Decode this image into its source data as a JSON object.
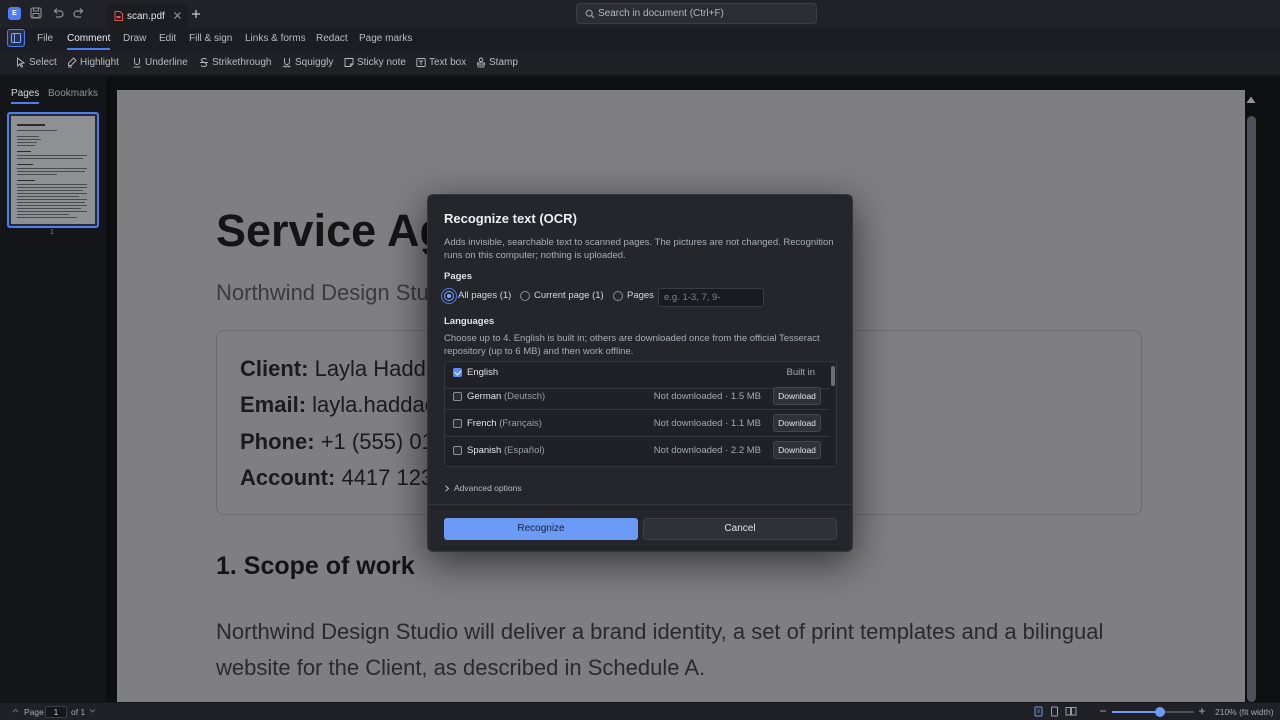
{
  "app": {
    "logo_letter": "E"
  },
  "tab": {
    "file_name": "scan.pdf"
  },
  "search": {
    "placeholder": "Search in document (Ctrl+F)"
  },
  "menu": [
    "File",
    "Comment",
    "Draw",
    "Edit",
    "Fill & sign",
    "Links & forms",
    "Redact",
    "Page marks"
  ],
  "menu_active": "Comment",
  "tools": [
    "Select",
    "Highlight",
    "Underline",
    "Strikethrough",
    "Squiggly",
    "Sticky note",
    "Text box",
    "Stamp"
  ],
  "sidebar": {
    "tabs": [
      "Pages",
      "Bookmarks"
    ],
    "active_tab": "Pages",
    "thumb_page_number": "1"
  },
  "document": {
    "title": "Service Ag",
    "subtitle": "Northwind Design Stud",
    "info": [
      {
        "key": "Client:",
        "value": "Layla Hadda"
      },
      {
        "key": "Email:",
        "value": "layla.haddad"
      },
      {
        "key": "Phone:",
        "value": "+1 (555) 014"
      },
      {
        "key": "Account:",
        "value": "4417 1234"
      }
    ],
    "section_heading": "1. Scope of work",
    "paragraph": "Northwind Design Studio will deliver a brand identity, a set of print templates and a bilingual website for the Client, as described in Schedule A."
  },
  "dialog": {
    "title": "Recognize text (OCR)",
    "description": "Adds invisible, searchable text to scanned pages. The pictures are not changed. Recognition runs on this computer; nothing is uploaded.",
    "pages_label": "Pages",
    "page_options": [
      {
        "label": "All pages (1)",
        "selected": true
      },
      {
        "label": "Current page (1)",
        "selected": false
      },
      {
        "label": "Pages",
        "selected": false
      }
    ],
    "pages_placeholder": "e.g. 1-3, 7, 9-",
    "languages_label": "Languages",
    "languages_hint": "Choose up to 4. English is built in; others are downloaded once from the official Tesseract repository (up to 6 MB) and then work offline.",
    "languages": [
      {
        "name": "English",
        "native": "",
        "checked": true,
        "status": "Built in",
        "action": ""
      },
      {
        "name": "German",
        "native": "(Deutsch)",
        "checked": false,
        "status": "Not downloaded · 1.5 MB",
        "action": "Download"
      },
      {
        "name": "French",
        "native": "(Français)",
        "checked": false,
        "status": "Not downloaded · 1.1 MB",
        "action": "Download"
      },
      {
        "name": "Spanish",
        "native": "(Español)",
        "checked": false,
        "status": "Not downloaded · 2.2 MB",
        "action": "Download"
      }
    ],
    "advanced_label": "Advanced options",
    "primary_button": "Recognize",
    "secondary_button": "Cancel"
  },
  "status": {
    "page_label": "Page",
    "page_value": "1",
    "page_total": "of 1",
    "zoom_label": "210% (fit width)",
    "zoom_level": 0.58
  },
  "colors": {
    "accent": "#4c7ef2",
    "primary_button": "#6b9af7"
  }
}
